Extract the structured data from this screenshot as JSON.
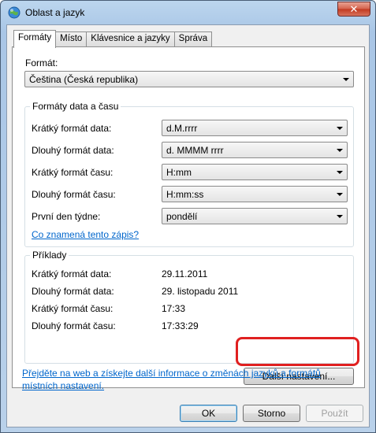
{
  "window": {
    "title": "Oblast a jazyk",
    "close_glyph": "✕"
  },
  "tabs": [
    "Formáty",
    "Místo",
    "Klávesnice a jazyky",
    "Správa"
  ],
  "format": {
    "label": "Formát:",
    "value": "Čeština (Česká republika)"
  },
  "datetime_group": {
    "legend": "Formáty data a času",
    "rows": [
      {
        "label": "Krátký formát data:",
        "value": "d.M.rrrr"
      },
      {
        "label": "Dlouhý formát data:",
        "value": "d. MMMM rrrr"
      },
      {
        "label": "Krátký formát času:",
        "value": "H:mm"
      },
      {
        "label": "Dlouhý formát času:",
        "value": "H:mm:ss"
      },
      {
        "label": "První den týdne:",
        "value": "pondělí"
      }
    ],
    "link": "Co znamená tento zápis?"
  },
  "examples": {
    "legend": "Příklady",
    "rows": [
      {
        "label": "Krátký formát data:",
        "value": "29.11.2011"
      },
      {
        "label": "Dlouhý formát data:",
        "value": "29. listopadu 2011"
      },
      {
        "label": "Krátký formát času:",
        "value": "17:33"
      },
      {
        "label": "Dlouhý formát času:",
        "value": "17:33:29"
      }
    ]
  },
  "more_settings_label": "Další nastavení...",
  "bottom_link": "Přejděte na web a získejte další informace o změnách jazyků a formátů místních nastavení.",
  "buttons": {
    "ok": "OK",
    "cancel": "Storno",
    "apply": "Použít"
  },
  "colors": {
    "link": "#0066cc",
    "highlight": "#e02020"
  }
}
